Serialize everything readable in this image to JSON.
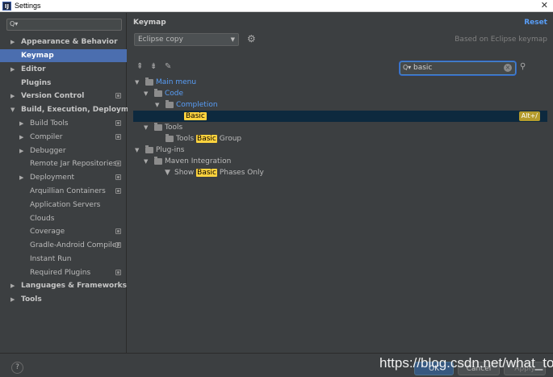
{
  "window": {
    "title": "Settings",
    "app_icon_letter": "IJ",
    "close_glyph": "✕"
  },
  "sidebar": {
    "search_glyph": "Q▾",
    "items": [
      {
        "label": "Appearance & Behavior"
      },
      {
        "label": "Keymap"
      },
      {
        "label": "Editor"
      },
      {
        "label": "Plugins"
      },
      {
        "label": "Version Control"
      },
      {
        "label": "Build, Execution, Deployment"
      },
      {
        "label": "Build Tools"
      },
      {
        "label": "Compiler"
      },
      {
        "label": "Debugger"
      },
      {
        "label": "Remote Jar Repositories"
      },
      {
        "label": "Deployment"
      },
      {
        "label": "Arquillian Containers"
      },
      {
        "label": "Application Servers"
      },
      {
        "label": "Clouds"
      },
      {
        "label": "Coverage"
      },
      {
        "label": "Gradle-Android Compiler"
      },
      {
        "label": "Instant Run"
      },
      {
        "label": "Required Plugins"
      },
      {
        "label": "Languages & Frameworks"
      },
      {
        "label": "Tools"
      }
    ]
  },
  "main": {
    "title": "Keymap",
    "reset_label": "Reset",
    "scheme_value": "Eclipse copy",
    "based_on": "Based on Eclipse keymap",
    "search_glyph": "Q▾",
    "search_value": "basic",
    "clear_glyph": "×"
  },
  "tree": {
    "main_menu": "Main menu",
    "code": "Code",
    "completion": "Completion",
    "basic": "Basic",
    "basic_shortcut": "Alt+/",
    "tools": "Tools",
    "tools_basic_group": {
      "pre": "Tools ",
      "hl": "Basic",
      "post": " Group"
    },
    "plug_ins": "Plug-ins",
    "maven_integration": "Maven Integration",
    "show_basic_phases": {
      "pre": "Show ",
      "hl": "Basic",
      "post": " Phases Only"
    }
  },
  "footer": {
    "help_label": "?",
    "ok_label": "OK",
    "cancel_label": "Cancel",
    "apply_label": "Apply"
  },
  "watermark": "https://blog.csdn.net/what_to"
}
